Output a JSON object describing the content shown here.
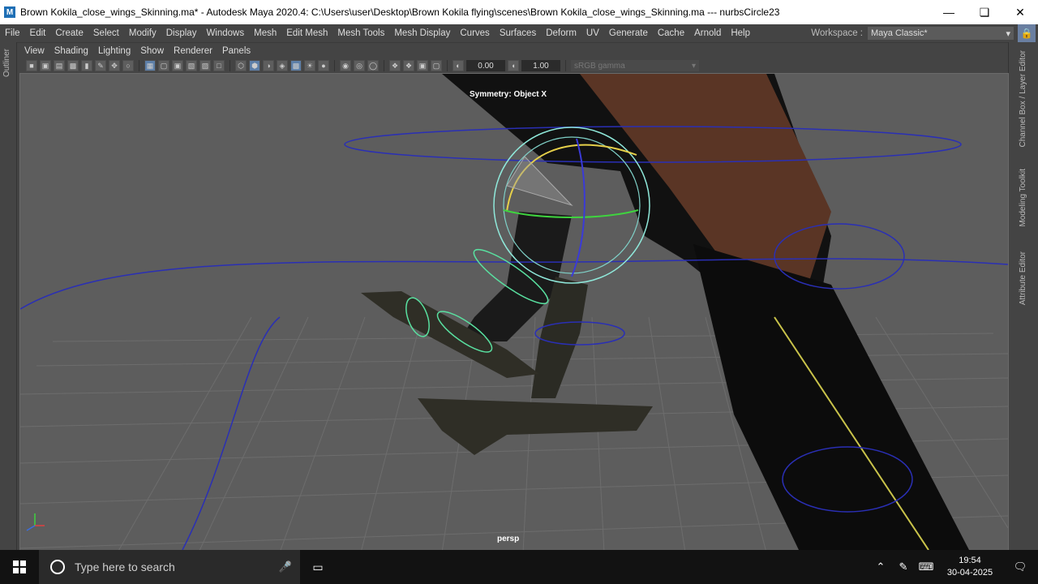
{
  "window": {
    "title": "Brown Kokila_close_wings_Skinning.ma* - Autodesk Maya 2020.4: C:\\Users\\user\\Desktop\\Brown Kokila flying\\scenes\\Brown Kokila_close_wings_Skinning.ma   ---   nurbsCircle23",
    "app_icon": "M"
  },
  "menu": [
    "File",
    "Edit",
    "Create",
    "Select",
    "Modify",
    "Display",
    "Windows",
    "Mesh",
    "Edit Mesh",
    "Mesh Tools",
    "Mesh Display",
    "Curves",
    "Surfaces",
    "Deform",
    "UV",
    "Generate",
    "Cache",
    "Arnold",
    "Help"
  ],
  "workspace": {
    "label": "Workspace :",
    "value": "Maya Classic*"
  },
  "left_strip": {
    "label": "Outliner"
  },
  "right_strip": [
    "Channel Box / Layer Editor",
    "Modeling Toolkit",
    "Attribute Editor"
  ],
  "panel_menu": [
    "View",
    "Shading",
    "Lighting",
    "Show",
    "Renderer",
    "Panels"
  ],
  "toolbar": {
    "exposure": "0.00",
    "gamma": "1.00",
    "color_space": "sRGB gamma"
  },
  "viewport": {
    "symmetry": "Symmetry: Object X",
    "camera": "persp"
  },
  "taskbar": {
    "search_placeholder": "Type here to search",
    "time": "19:54",
    "date": "30-04-2025"
  }
}
